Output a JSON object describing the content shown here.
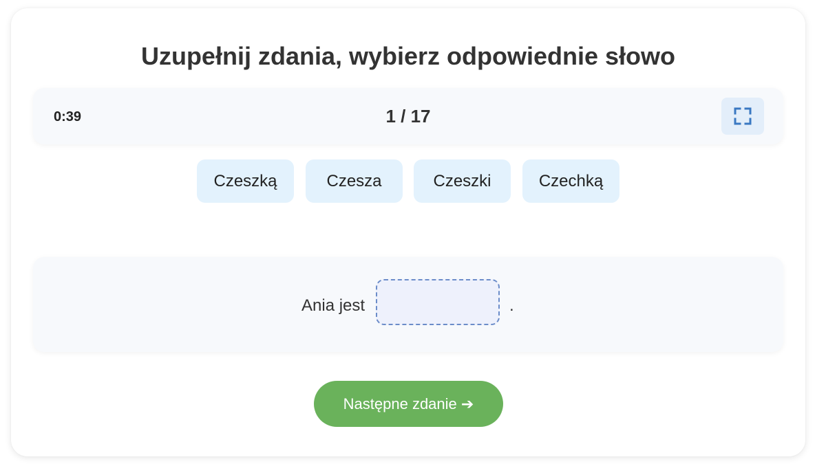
{
  "title": "Uzupełnij zdania, wybierz odpowiednie słowo",
  "status_bar": {
    "timer": "0:39",
    "progress": "1 / 17",
    "fullscreen_icon": "fullscreen-icon"
  },
  "word_options": [
    {
      "label": "Czeszką"
    },
    {
      "label": "Czesza"
    },
    {
      "label": "Czeszki"
    },
    {
      "label": "Czechką"
    }
  ],
  "sentence": {
    "before": "Ania jest",
    "blank": "",
    "after": "."
  },
  "next_button": {
    "label": "Następne zdanie ➔"
  },
  "colors": {
    "option_bg": "#e3f2fd",
    "next_button_bg": "#6ab25b",
    "drop_zone_border": "#6b8cc9",
    "fullscreen_icon": "#3a78c2"
  }
}
